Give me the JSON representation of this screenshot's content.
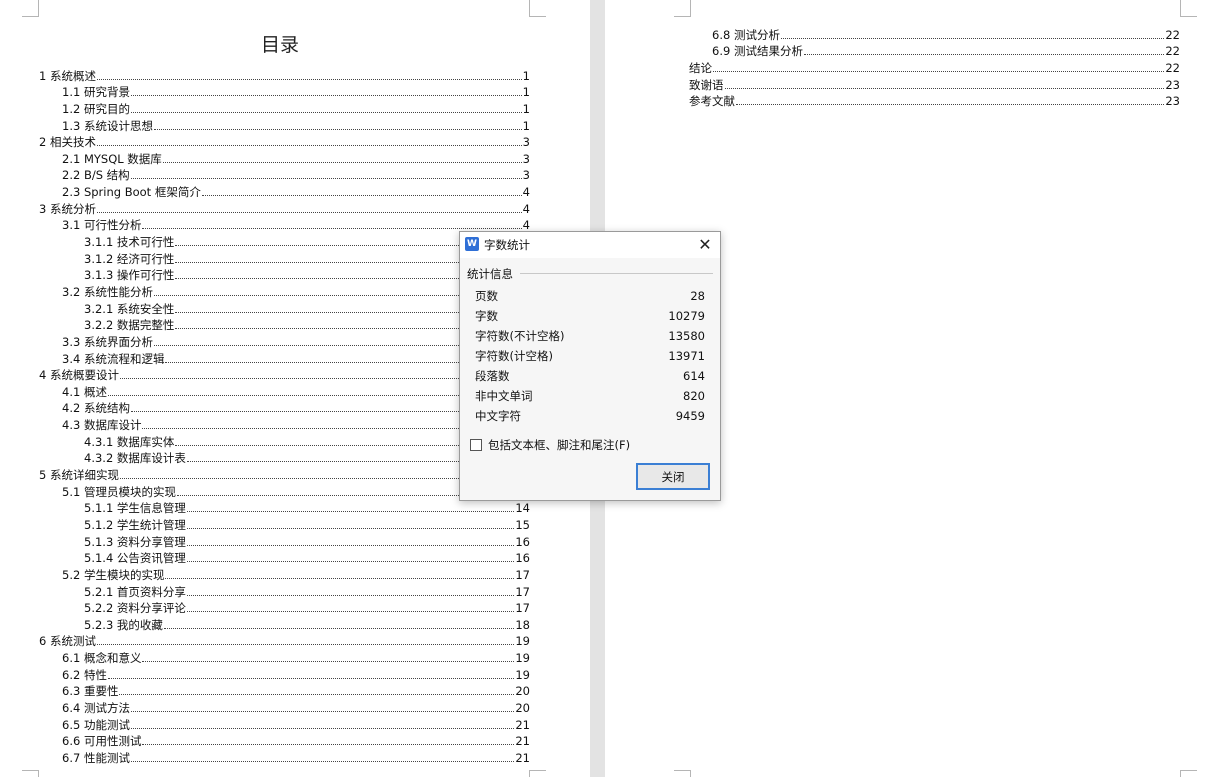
{
  "toc": {
    "title": "目录",
    "left_entries": [
      {
        "text": "1 系统概述",
        "page": "1",
        "level": 1
      },
      {
        "text": "1.1  研究背景",
        "page": "1",
        "level": 2
      },
      {
        "text": "1.2 研究目的",
        "page": "1",
        "level": 2
      },
      {
        "text": "1.3 系统设计思想",
        "page": "1",
        "level": 2
      },
      {
        "text": "2 相关技术",
        "page": "3",
        "level": 1
      },
      {
        "text": "2.1 MYSQL 数据库",
        "page": "3",
        "level": 2
      },
      {
        "text": "2.2 B/S 结构",
        "page": "3",
        "level": 2
      },
      {
        "text": "2.3 Spring Boot 框架简介",
        "page": "4",
        "level": 2
      },
      {
        "text": "3 系统分析",
        "page": "4",
        "level": 1
      },
      {
        "text": "3.1 可行性分析",
        "page": "4",
        "level": 2
      },
      {
        "text": "3.1.1 技术可行性",
        "page": "",
        "level": 3
      },
      {
        "text": "3.1.2 经济可行性",
        "page": "",
        "level": 3
      },
      {
        "text": "3.1.3 操作可行性",
        "page": "",
        "level": 3
      },
      {
        "text": "3.2 系统性能分析",
        "page": "",
        "level": 2
      },
      {
        "text": "3.2.1  系统安全性",
        "page": "",
        "level": 3
      },
      {
        "text": "3.2.2  数据完整性",
        "page": "",
        "level": 3
      },
      {
        "text": "3.3 系统界面分析",
        "page": "",
        "level": 2
      },
      {
        "text": "3.4 系统流程和逻辑",
        "page": "",
        "level": 2
      },
      {
        "text": "4 系统概要设计",
        "page": "",
        "level": 1
      },
      {
        "text": "4.1 概述",
        "page": "",
        "level": 2
      },
      {
        "text": "4.2 系统结构",
        "page": "",
        "level": 2
      },
      {
        "text": "4.3 数据库设计",
        "page": "",
        "level": 2
      },
      {
        "text": "4.3.1 数据库实体",
        "page": "",
        "level": 3
      },
      {
        "text": "4.3.2 数据库设计表",
        "page": "",
        "level": 3
      },
      {
        "text": "5 系统详细实现",
        "page": "",
        "level": 1
      },
      {
        "text": "5.1  管理员模块的实现",
        "page": "",
        "level": 2
      },
      {
        "text": "5.1.1  学生信息管理",
        "page": "14",
        "level": 3
      },
      {
        "text": "5.1.2  学生统计管理",
        "page": "15",
        "level": 3
      },
      {
        "text": "5.1.3  资料分享管理",
        "page": "16",
        "level": 3
      },
      {
        "text": "5.1.4  公告资讯管理",
        "page": "16",
        "level": 3
      },
      {
        "text": "5.2  学生模块的实现",
        "page": "17",
        "level": 2
      },
      {
        "text": "5.2.1  首页资料分享",
        "page": "17",
        "level": 3
      },
      {
        "text": "5.2.2  资料分享评论",
        "page": "17",
        "level": 3
      },
      {
        "text": "5.2.3  我的收藏",
        "page": "18",
        "level": 3
      },
      {
        "text": "6 系统测试",
        "page": "19",
        "level": 1
      },
      {
        "text": "6.1 概念和意义",
        "page": "19",
        "level": 2
      },
      {
        "text": "6.2 特性",
        "page": "19",
        "level": 2
      },
      {
        "text": "6.3 重要性",
        "page": "20",
        "level": 2
      },
      {
        "text": "6.4 测试方法",
        "page": "20",
        "level": 2
      },
      {
        "text": "6.5  功能测试",
        "page": "21",
        "level": 2
      },
      {
        "text": "6.6 可用性测试",
        "page": "21",
        "level": 2
      },
      {
        "text": "6.7 性能测试",
        "page": "21",
        "level": 2
      }
    ],
    "right_entries": [
      {
        "text": "6.8 测试分析",
        "page": "22",
        "level": 2
      },
      {
        "text": "6.9 测试结果分析",
        "page": "22",
        "level": 2
      },
      {
        "text": "结论",
        "page": "22",
        "level": 1
      },
      {
        "text": "致谢语",
        "page": "23",
        "level": 1
      },
      {
        "text": "参考文献",
        "page": "23",
        "level": 1
      }
    ]
  },
  "dialog": {
    "app_icon": "W",
    "title": "字数统计",
    "section": "统计信息",
    "stats": [
      {
        "label": "页数",
        "value": "28"
      },
      {
        "label": "字数",
        "value": "10279"
      },
      {
        "label": "字符数(不计空格)",
        "value": "13580"
      },
      {
        "label": "字符数(计空格)",
        "value": "13971"
      },
      {
        "label": "段落数",
        "value": "614"
      },
      {
        "label": "非中文单词",
        "value": "820"
      },
      {
        "label": "中文字符",
        "value": "9459"
      }
    ],
    "checkbox_label": "包括文本框、脚注和尾注(F)",
    "checkbox_checked": false,
    "close_button": "关闭",
    "close_icon": "✕"
  }
}
